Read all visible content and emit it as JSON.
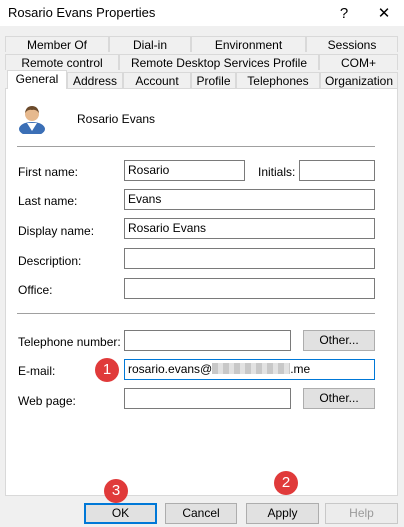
{
  "window": {
    "title": "Rosario Evans Properties",
    "help_glyph": "?",
    "close_glyph": "✕"
  },
  "tabs": {
    "row1": [
      "Member Of",
      "Dial-in",
      "Environment",
      "Sessions"
    ],
    "row2": [
      "Remote control",
      "Remote Desktop Services Profile",
      "COM+"
    ],
    "row3": [
      "General",
      "Address",
      "Account",
      "Profile",
      "Telephones",
      "Organization"
    ],
    "active": "General"
  },
  "general": {
    "user_display": "Rosario Evans",
    "first_name": {
      "label": "First name:",
      "value": "Rosario"
    },
    "initials": {
      "label": "Initials:",
      "value": ""
    },
    "last_name": {
      "label": "Last name:",
      "value": "Evans"
    },
    "display_name": {
      "label": "Display name:",
      "value": "Rosario Evans"
    },
    "description": {
      "label": "Description:",
      "value": ""
    },
    "office": {
      "label": "Office:",
      "value": ""
    },
    "telephone": {
      "label": "Telephone number:",
      "value": "",
      "other_label": "Other..."
    },
    "email": {
      "label": "E-mail:",
      "value_prefix": "rosario.evans@",
      "value_suffix": ".me"
    },
    "web_page": {
      "label": "Web page:",
      "value": "",
      "other_label": "Other..."
    }
  },
  "buttons": {
    "ok": "OK",
    "cancel": "Cancel",
    "apply": "Apply",
    "help": "Help"
  },
  "callouts": [
    "1",
    "2",
    "3"
  ],
  "colors": {
    "focus": "#0078d7",
    "callout": "#e03a3a"
  }
}
